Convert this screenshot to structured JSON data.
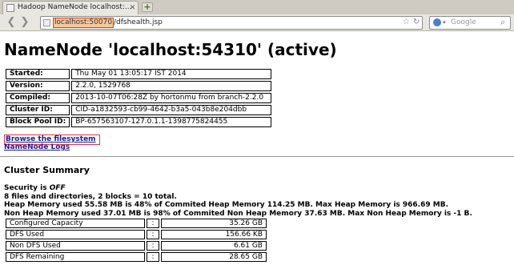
{
  "browser": {
    "tab_title": "Hadoop NameNode localhost:...",
    "tab_close": "✕",
    "new_tab": "+",
    "url_host": "localhost:50070",
    "url_path": "/dfshealth.jsp",
    "search_placeholder": "Google"
  },
  "page": {
    "title": "NameNode 'localhost:54310' (active)",
    "info": [
      {
        "key": "Started:",
        "value": "Thu May 01 13:05:17 IST 2014"
      },
      {
        "key": "Version:",
        "value": "2.2.0, 1529768"
      },
      {
        "key": "Compiled:",
        "value": "2013-10-07T06:28Z by hortonmu from branch-2.2.0"
      },
      {
        "key": "Cluster ID:",
        "value": "CID-a1832593-cb99-4642-b3a5-043b8e204dbb"
      },
      {
        "key": "Block Pool ID:",
        "value": "BP-657563107-127.0.1.1-1398775824455"
      }
    ],
    "browse_link": "Browse the filesystem",
    "logs_link": "NameNode Logs",
    "summary_heading": "Cluster Summary",
    "security_prefix": "Security is ",
    "security_value": "OFF",
    "files_line": "8 files and directories, 2 blocks = 10 total.",
    "heap_line": "Heap Memory used 55.58 MB is 48% of Commited Heap Memory 114.25 MB. Max Heap Memory is 966.69 MB.",
    "nonheap_line": "Non Heap Memory used 37.01 MB is 98% of Commited Non Heap Memory 37.63 MB. Max Non Heap Memory is -1 B.",
    "stats": [
      {
        "key": "Configured Capacity",
        "sep": ":",
        "value": "35.26 GB"
      },
      {
        "key": "DFS Used",
        "sep": ":",
        "value": "156.66 KB"
      },
      {
        "key": "Non DFS Used",
        "sep": ":",
        "value": "6.61 GB"
      },
      {
        "key": "DFS Remaining",
        "sep": ":",
        "value": "28.65 GB"
      }
    ]
  }
}
